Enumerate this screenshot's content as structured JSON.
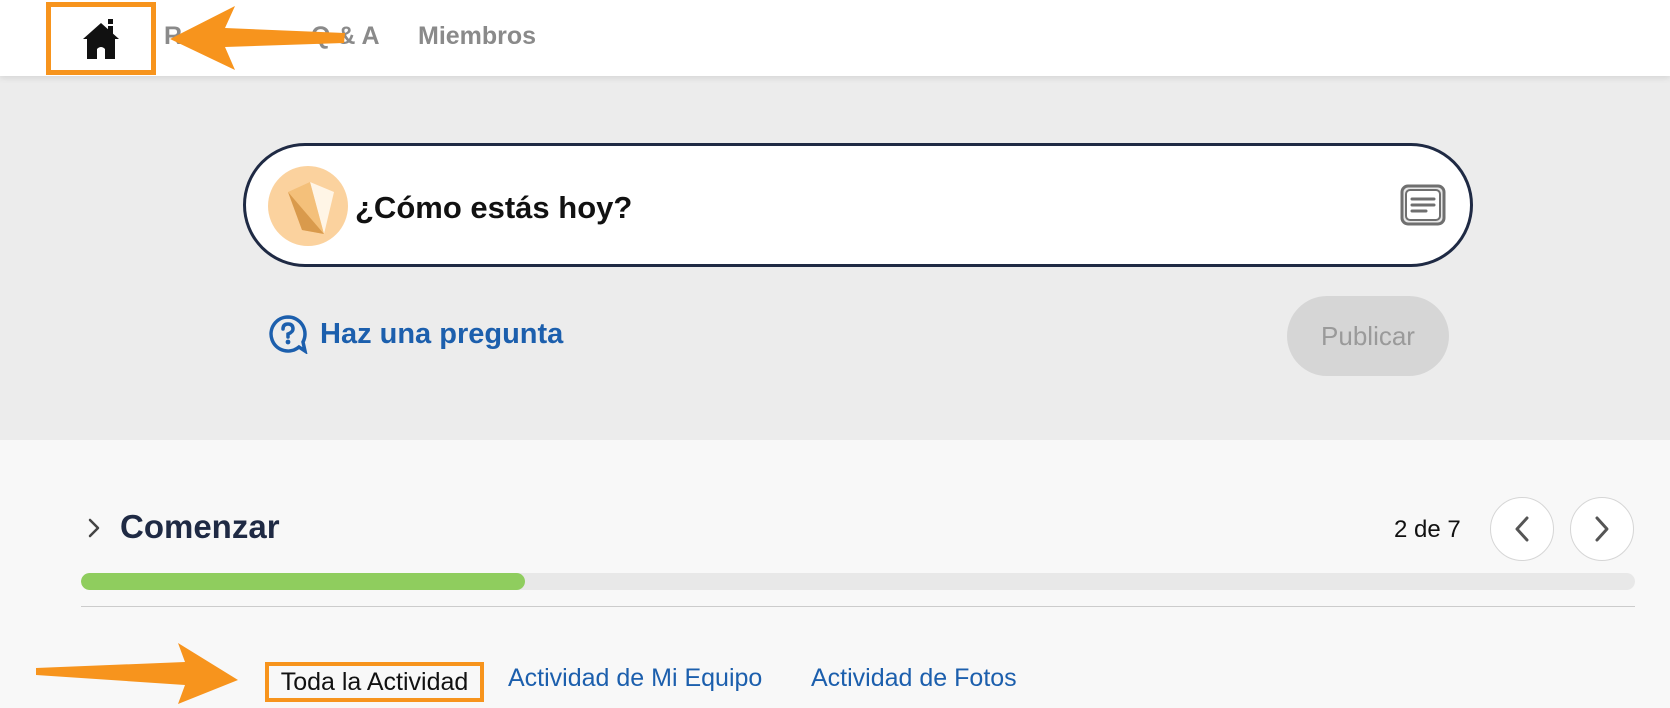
{
  "nav": {
    "home_icon": "home-icon",
    "links": [
      "Recursos",
      "Q & A",
      "Miembros"
    ]
  },
  "composer": {
    "prompt": "¿Cómo estás hoy?",
    "avatar_icon": "avatar-icon",
    "note_icon": "note-icon"
  },
  "ask": {
    "label": "Haz una pregunta",
    "icon": "question-bubble-icon"
  },
  "publish": {
    "label": "Publicar"
  },
  "getting_started": {
    "title": "Comenzar",
    "counter": "2 de 7",
    "progress_fraction": 0.286
  },
  "activity_tabs": [
    "Toda la Actividad",
    "Actividad de Mi Equipo",
    "Actividad de Fotos"
  ],
  "colors": {
    "accent_orange": "#f7941d",
    "link_blue": "#1c5fad",
    "progress_green": "#8fcd5e",
    "dark_navy": "#1f2a44"
  }
}
